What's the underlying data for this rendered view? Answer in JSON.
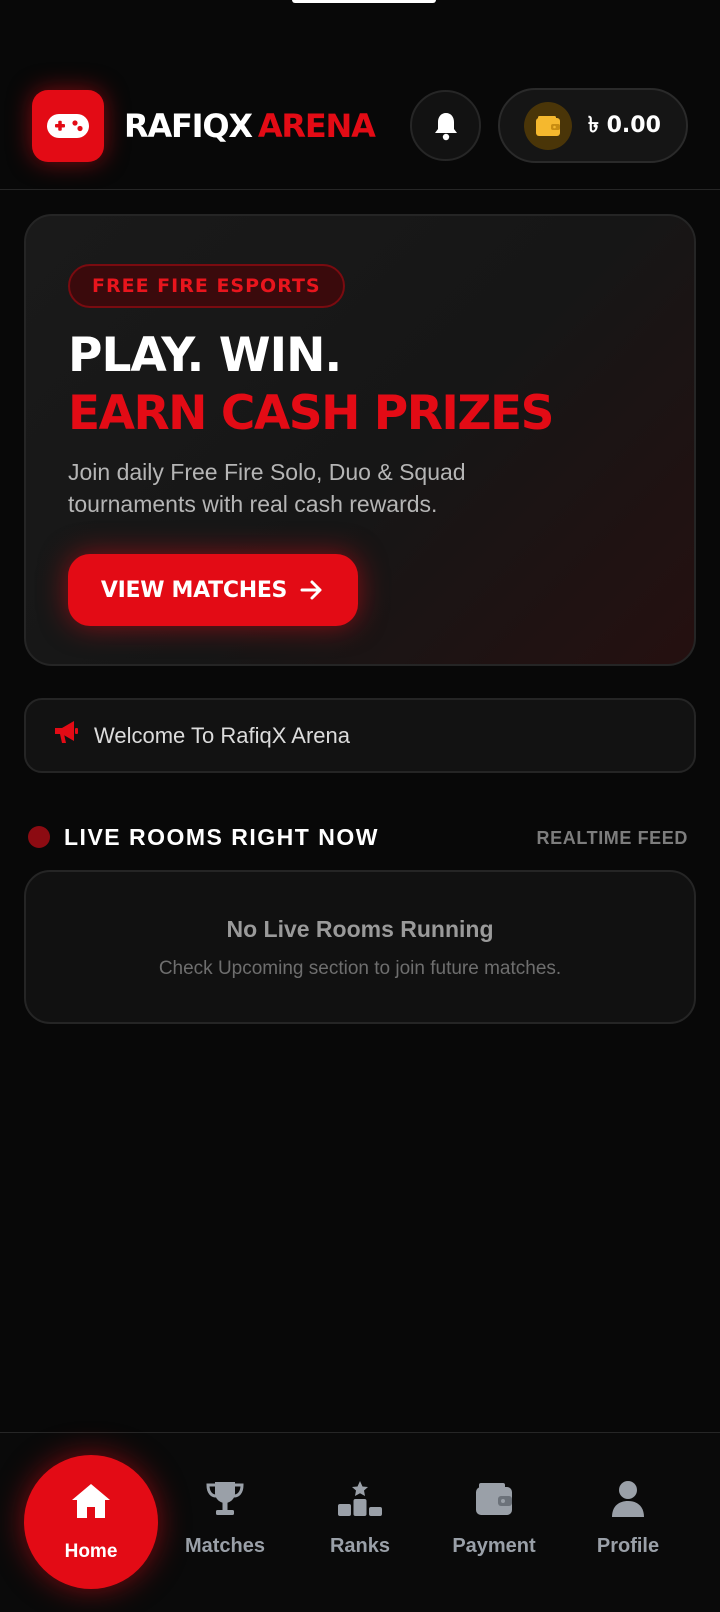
{
  "header": {
    "brand_part1": "RAFIQX",
    "brand_part2": "ARENA",
    "balance": "৳ 0.00",
    "icons": {
      "logo": "gamepad-icon",
      "notifications": "bell-icon",
      "wallet": "wallet-icon"
    }
  },
  "hero": {
    "badge": "FREE FIRE ESPORTS",
    "headline_line1": "PLAY. WIN.",
    "headline_line2": "EARN CASH PRIZES",
    "description": "Join daily Free Fire Solo, Duo & Squad tournaments with real cash rewards.",
    "cta_label": "VIEW MATCHES",
    "cta_icon": "arrow-right-icon"
  },
  "announcement": {
    "icon": "megaphone-icon",
    "text": "Welcome To RafiqX Arena"
  },
  "live_rooms": {
    "title": "LIVE ROOMS RIGHT NOW",
    "feed_label": "REALTIME FEED",
    "empty_title": "No Live Rooms Running",
    "empty_subtitle": "Check Upcoming section to join future matches."
  },
  "bottom_nav": {
    "items": [
      {
        "label": "Home",
        "icon": "home-icon",
        "active": true
      },
      {
        "label": "Matches",
        "icon": "trophy-icon"
      },
      {
        "label": "Ranks",
        "icon": "podium-icon"
      },
      {
        "label": "Payment",
        "icon": "wallet-icon"
      },
      {
        "label": "Profile",
        "icon": "user-icon"
      }
    ]
  },
  "colors": {
    "accent": "#e30b15",
    "background": "#080808",
    "card": "#121212",
    "wallet_gold": "#f5b82e"
  }
}
